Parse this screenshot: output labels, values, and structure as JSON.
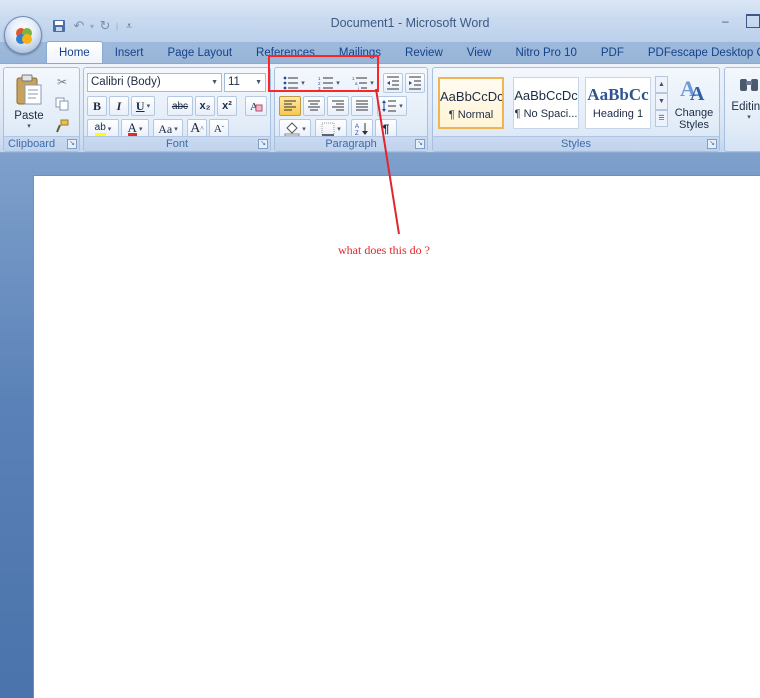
{
  "window": {
    "title": "Document1 - Microsoft Word"
  },
  "quick_access": {
    "save": "save-icon",
    "undo": "undo-icon",
    "redo": "redo-icon",
    "customize": "customize-qat-icon"
  },
  "tabs": [
    {
      "label": "Home",
      "active": true
    },
    {
      "label": "Insert"
    },
    {
      "label": "Page Layout"
    },
    {
      "label": "References"
    },
    {
      "label": "Mailings"
    },
    {
      "label": "Review"
    },
    {
      "label": "View"
    },
    {
      "label": "Nitro Pro 10"
    },
    {
      "label": "PDF"
    },
    {
      "label": "PDFescape Desktop Creator"
    }
  ],
  "ribbon": {
    "clipboard": {
      "label": "Clipboard",
      "paste_label": "Paste"
    },
    "font": {
      "label": "Font",
      "family": "Calibri (Body)",
      "size": "11",
      "bold": "B",
      "italic": "I",
      "underline": "U",
      "strikethrough": "abc",
      "subscript": "x₂",
      "superscript": "x²",
      "highlight": "ab",
      "font_color": "A",
      "change_case": "Aa",
      "grow": "A",
      "shrink": "A",
      "font_color_hex": "#e8271f",
      "highlight_hex": "#ffff00"
    },
    "paragraph": {
      "label": "Paragraph",
      "pilcrow": "¶"
    },
    "styles": {
      "label": "Styles",
      "items": [
        {
          "sample": "AaBbCcDc",
          "name": "¶ Normal",
          "selected": true
        },
        {
          "sample": "AaBbCcDc",
          "name": "¶ No Spaci..."
        },
        {
          "sample": "AaBbCc",
          "name": "Heading 1"
        }
      ],
      "change_styles": "Change Styles"
    },
    "editing": {
      "label": "Editing"
    }
  },
  "annotation": {
    "text": "what does this do ?",
    "color": "#e0262d"
  }
}
